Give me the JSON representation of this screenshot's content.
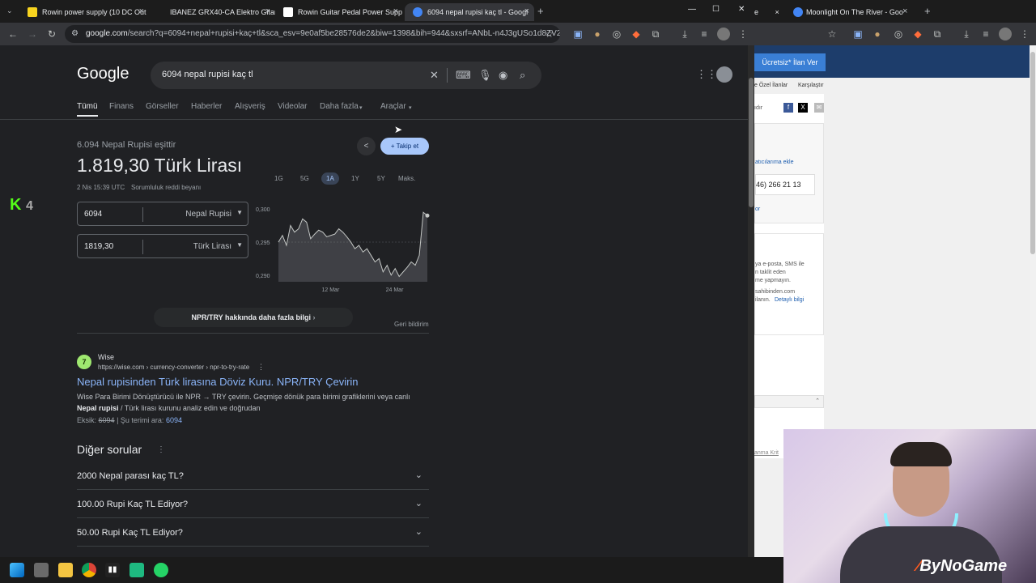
{
  "tabs": [
    {
      "title": "Rowin power supply (10 DC Out",
      "icon_color": "#f7d31f"
    },
    {
      "title": "IBANEZ GRX40-CA Elektro Gitar",
      "icon_color": "#3b3b3b"
    },
    {
      "title": "Rowin Guitar Pedal Power Supp",
      "icon_color": "#ffffff"
    },
    {
      "title": "6094 nepal rupisi kaç tl - Googl",
      "icon_color": "#4285f4"
    }
  ],
  "right_tabs": [
    {
      "title": "e"
    },
    {
      "title": "Moonlight On The River - Goo"
    }
  ],
  "window_controls": {
    "minimize": "—",
    "maximize": "☐",
    "close": "✕"
  },
  "address": {
    "host": "google.com",
    "path": "/search?q=6094+nepal+rupisi+kaç+tl&sca_esv=9e0af5be28576de2&biw=1398&bih=944&sxsrf=ANbL-n4J3gUSo1d8ZV2k..."
  },
  "google": {
    "logo": "Google",
    "query": "6094 nepal rupisi kaç tl",
    "nav": [
      "Tümü",
      "Finans",
      "Görseller",
      "Haberler",
      "Alışveriş",
      "Videolar",
      "Daha fazla",
      "Araçlar"
    ],
    "converter": {
      "caption": "6.094 Nepal Rupisi eşittir",
      "result": "1.819,30 Türk Lirası",
      "timestamp": "2 Nis 15:39 UTC",
      "disclaimer": "Sorumluluk reddi beyanı",
      "follow_label": "Takip et",
      "from_value": "6094",
      "from_currency": "Nepal Rupisi",
      "to_value": "1819,30",
      "to_currency": "Türk Lirası",
      "ranges": [
        "1G",
        "5G",
        "1A",
        "1Y",
        "5Y",
        "Maks."
      ],
      "selected_range": "1A",
      "more_info": "NPR/TRY hakkında daha fazla bilgi",
      "feedback": "Geri bildirim"
    },
    "result": {
      "site": "Wise",
      "breadcrumb": "https://wise.com › currency-converter › npr-to-try-rate",
      "title": "Nepal rupisinden Türk lirasına Döviz Kuru. NPR/TRY Çevirin",
      "snippet1": "Wise Para Birimi Dönüştürücü ile NPR → TRY çevirin. Geçmişe dönük para birimi grafiklerini veya canlı",
      "snippet2_bold": "Nepal rupisi",
      "snippet2": " / Türk lirası kurunu analiz edin ve doğrudan",
      "missing_label": "Eksik:",
      "missing_term": "6094",
      "must_include": "| Şu terimi ara:",
      "must_term": "6094"
    },
    "faq_title": "Diğer sorular",
    "faq": [
      "2000 Nepal parası kaç TL?",
      "100.00 Rupi Kaç TL Ediyor?",
      "50.00 Rupi Kaç TL Ediyor?"
    ]
  },
  "right_page": {
    "post_button": "Ücretsiz* İlan Ver",
    "links": [
      "e Özel İlanlar",
      "Karşılaştır"
    ],
    "share_label": "ıdır",
    "add_fav": "atıcılarıma ekle",
    "phone": "46) 266 21 13",
    "short_link": "or",
    "warn1": "ya e-posta, SMS ile",
    "warn2": "n taklit eden",
    "warn3": "me yapmayın.",
    "warn4": "sahibinden.com",
    "warn5": "ilanın.",
    "detail_link": "Detaylı bilgi",
    "bottom_link": "anma Krit"
  },
  "chart_data": {
    "type": "line",
    "x_tick_labels": [
      "12 Mar",
      "24 Mar"
    ],
    "y_tick_labels": [
      "0,300",
      "0,295",
      "0,290"
    ],
    "ylim": [
      0.289,
      0.3005
    ],
    "values": [
      0.295,
      0.296,
      0.2945,
      0.2975,
      0.2965,
      0.297,
      0.2985,
      0.298,
      0.2955,
      0.2962,
      0.2968,
      0.2965,
      0.2958,
      0.296,
      0.2962,
      0.297,
      0.2965,
      0.2958,
      0.295,
      0.294,
      0.2945,
      0.2935,
      0.294,
      0.293,
      0.292,
      0.2925,
      0.2905,
      0.2915,
      0.29,
      0.291,
      0.2898,
      0.2905,
      0.2912,
      0.292,
      0.2915,
      0.293,
      0.2995,
      0.299
    ]
  },
  "webcam": {
    "brand": "ByNoGame"
  },
  "overlay_badge": {
    "letter": "K",
    "number": "4"
  }
}
